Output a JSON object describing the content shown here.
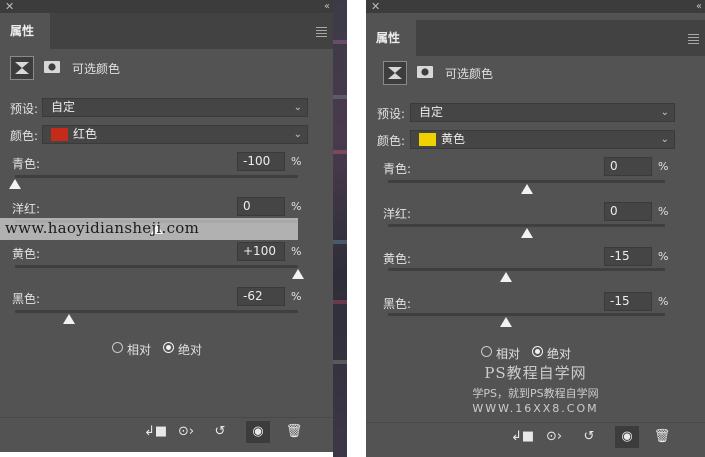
{
  "panel_tab": "属性",
  "adjustment_title": "可选颜色",
  "preset_label": "预设:",
  "color_label": "颜色:",
  "percent_sign": "%",
  "method_relative": "相对",
  "method_absolute": "绝对",
  "left": {
    "preset_value": "自定",
    "color_value": "红色",
    "color_swatch": "#c62a18",
    "sliders": [
      {
        "label": "青色:",
        "value": "-100",
        "level_percent": -100
      },
      {
        "label": "洋红:",
        "value": "0",
        "level_percent": 0
      },
      {
        "label": "黄色:",
        "value": "+100",
        "level_percent": 100
      },
      {
        "label": "黑色:",
        "value": "-62",
        "level_percent": -62
      }
    ],
    "method_selected": "absolute"
  },
  "right": {
    "preset_value": "自定",
    "color_value": "黄色",
    "color_swatch": "#f0d000",
    "sliders": [
      {
        "label": "青色:",
        "value": "0",
        "level_percent": 0
      },
      {
        "label": "洋红:",
        "value": "0",
        "level_percent": 0
      },
      {
        "label": "黄色:",
        "value": "-15",
        "level_percent": -15
      },
      {
        "label": "黑色:",
        "value": "-15",
        "level_percent": -15
      }
    ],
    "method_selected": "absolute"
  },
  "toolbar_icons": [
    "clip-to-layer-icon",
    "view-previous-state-icon",
    "reset-icon",
    "visibility-eye-icon",
    "trash-icon"
  ],
  "watermark_url": "www.haoyidiansheji.com",
  "watermark_ps_title": "PS教程自学网",
  "watermark_ps_sub": "学PS，就到PS教程自学网",
  "watermark_ps_url": "WWW.16XX8.COM"
}
